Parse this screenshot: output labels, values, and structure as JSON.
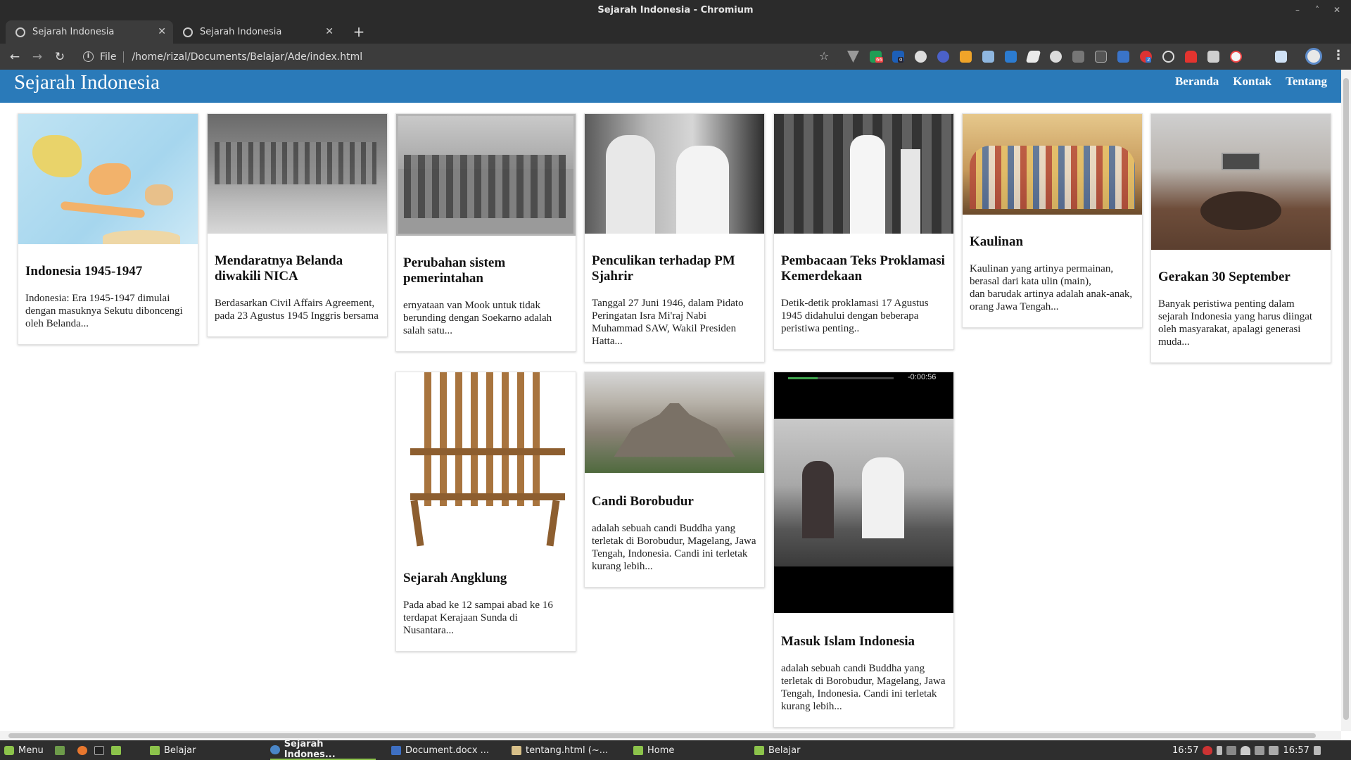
{
  "window": {
    "title": "Sejarah Indonesia - Chromium"
  },
  "browser": {
    "tabs": [
      {
        "label": "Sejarah Indonesia",
        "active": true
      },
      {
        "label": "Sejarah Indonesia",
        "active": false
      }
    ],
    "address": {
      "scheme_label": "File",
      "url": "/home/rizal/Documents/Belajar/Ade/index.html"
    },
    "extension_badges": [
      "66",
      "0",
      "2"
    ]
  },
  "site": {
    "title": "Sejarah Indonesia",
    "nav": [
      "Beranda",
      "Kontak",
      "Tentang"
    ]
  },
  "cards": [
    {
      "title": "Indonesia 1945-1947",
      "text": "Indonesia: Era 1945-1947 dimulai dengan masuknya Sekutu diboncengi oleh Belanda...",
      "image": "map-indonesia"
    },
    {
      "title": "Mendaratnya Belanda diwakili NICA",
      "text": "Berdasarkan Civil Affairs Agreement, pada 23 Agustus 1945 Inggris bersama",
      "image": "soldiers-marching-photo"
    },
    {
      "title": "Perubahan sistem pemerintahan",
      "text": "ernyataan van Mook untuk tidak berunding dengan Soekarno adalah salah satu...",
      "image": "troops-parade-photo"
    },
    {
      "title": "Penculikan terhadap PM Sjahrir",
      "text": "Tanggal 27 Juni 1946, dalam Pidato Peringatan Isra Mi'raj Nabi Muhammad SAW, Wakil Presiden Hatta...",
      "image": "two-men-photo"
    },
    {
      "title": "Pembacaan Teks Proklamasi Kemerdekaan",
      "text": "Detik-detik proklamasi 17 Agustus 1945 didahului dengan beberapa peristiwa penting..",
      "image": "proclamation-photo"
    },
    {
      "title": "Kaulinan",
      "text": "Kaulinan yang artinya permainan, berasal dari kata ulin (main),\ndan barudak artinya adalah anak-anak, orang Jawa Tengah...",
      "image": "children-playing-photo"
    },
    {
      "title": "Gerakan 30 September",
      "text": "Banyak peristiwa penting dalam sejarah Indonesia yang harus diingat oleh masyarakat, apalagi generasi muda...",
      "image": "well-monument-photo"
    },
    {
      "title": "Sejarah Angklung",
      "text": "Pada abad ke 12 sampai abad ke 16 terdapat Kerajaan Sunda di Nusantara...",
      "image": "angklung-photo"
    },
    {
      "title": "Candi Borobudur",
      "text": "adalah sebuah candi Buddha yang terletak di Borobudur, Magelang, Jawa Tengah, Indonesia. Candi ini terletak kurang lebih...",
      "image": "borobudur-photo"
    },
    {
      "title": "Masuk Islam Indonesia",
      "text": "adalah sebuah candi Buddha yang terletak di Borobudur, Magelang, Jawa Tengah, Indonesia. Candi ini terletak kurang lebih...",
      "image": "video-player",
      "video_time": "-0:00:56"
    }
  ],
  "taskbar": {
    "menu_label": "Menu",
    "items": [
      "Belajar",
      "Sejarah Indones...",
      "Document.docx ...",
      "tentang.html (~...",
      "Home",
      "Belajar"
    ],
    "clock": "16:57",
    "clock2": "16:57"
  }
}
